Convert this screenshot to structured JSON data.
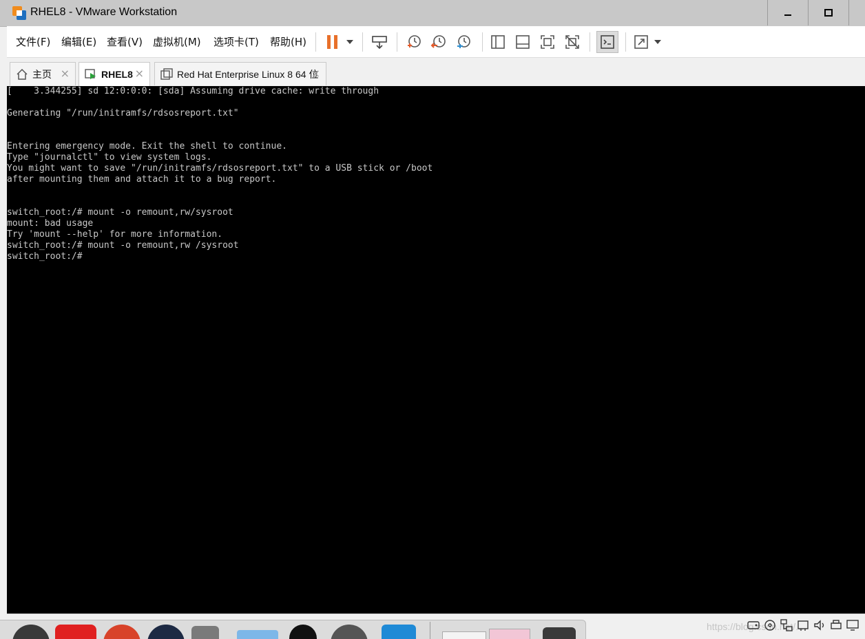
{
  "window": {
    "title": "RHEL8 - VMware Workstation"
  },
  "menu": {
    "items": [
      "文件(F)",
      "编辑(E)",
      "查看(V)",
      "虚拟机(M)",
      "选项卡(T)",
      "帮助(H)"
    ]
  },
  "toolbar": {
    "buttons": [
      "pause-icon",
      "send-ctrl-alt-del-icon",
      "snapshot-take-icon",
      "snapshot-revert-icon",
      "snapshot-manager-icon",
      "show-library-icon",
      "thumbnail-bar-icon",
      "fit-guest-icon",
      "unity-icon",
      "console-view-icon",
      "full-screen-icon"
    ],
    "accent_pause": "#e8702a",
    "accent_snapshot": "#e35a2a",
    "accent_revert": "#2a8ccf"
  },
  "tabs": [
    {
      "label": "主页",
      "icon": "home-icon",
      "active": false
    },
    {
      "label": "RHEL8",
      "icon": "vm-running-icon",
      "active": true
    },
    {
      "label": "Red Hat Enterprise Linux 8 64 位",
      "icon": "vm-clone-icon",
      "active": false
    }
  ],
  "console": {
    "background": "#000000",
    "text_color": "#c8c8c8",
    "lines": [
      "[    3.344255] sd 12:0:0:0: [sda] Assuming drive cache: write through",
      "",
      "Generating \"/run/initramfs/rdsosreport.txt\"",
      "",
      "",
      "Entering emergency mode. Exit the shell to continue.",
      "Type \"journalctl\" to view system logs.",
      "You might want to save \"/run/initramfs/rdsosreport.txt\" to a USB stick or /boot",
      "after mounting them and attach it to a bug report.",
      "",
      "",
      "switch_root:/# mount -o remount,rw/sysroot",
      "mount: bad usage",
      "Try 'mount --help' for more information.",
      "switch_root:/# mount -o remount,rw /sysroot",
      "switch_root:/#"
    ]
  },
  "statusbar": {
    "watermark": "https://blog.csdn.net/..."
  }
}
